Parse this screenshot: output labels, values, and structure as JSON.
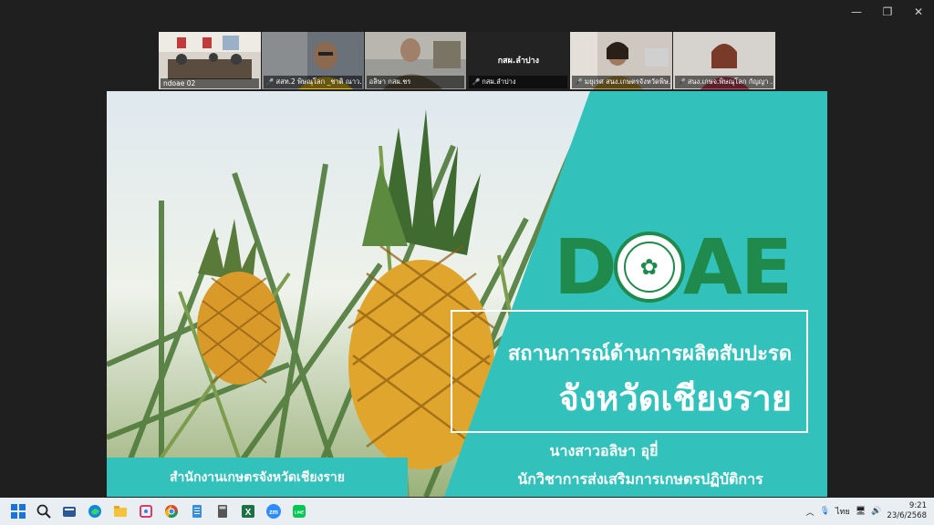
{
  "window": {
    "controls": {
      "minimize": "—",
      "restore": "❐",
      "close": "✕"
    }
  },
  "participants": [
    {
      "name": "ndoae 02",
      "mic_off": false,
      "active": false
    },
    {
      "name": "สสท.2 พิษณุโลก _ชาติ ณาว...",
      "mic_off": true,
      "active": false
    },
    {
      "name": "อลิษา กสผ.ชร",
      "mic_off": false,
      "active": true
    },
    {
      "name": "กสผ.ลำปาง",
      "center_label": "กสผ.ลำปาง",
      "mic_off": true,
      "active": false
    },
    {
      "name": "มยุเรศ สนง.เกษตรจังหวัดพิษ...",
      "mic_off": true,
      "active": false
    },
    {
      "name": "สนง.เกษจ.พิษณุโลก กัญญา ...",
      "mic_off": true,
      "active": false
    }
  ],
  "slide": {
    "logo_left": "D",
    "logo_right": "AE",
    "title_line1": "สถานการณ์ด้านการผลิตสับปะรด",
    "title_line2": "จังหวัดเชียงราย",
    "presenter_name": "นางสาวอลิษา  อุยี่",
    "presenter_role": "นักวิชาการส่งเสริมการเกษตรปฏิบัติการ",
    "office": "สำนักงานเกษตรจังหวัดเชียงราย",
    "colors": {
      "teal": "#33c2bb",
      "green": "#1f8a4c"
    }
  },
  "taskbar": {
    "apps": [
      "windows-start-icon",
      "search-icon",
      "task-view-icon",
      "edge-icon",
      "file-explorer-icon",
      "snipping-icon",
      "chrome-icon",
      "notepad-icon",
      "calculator-icon",
      "excel-icon",
      "zoom-icon",
      "line-icon"
    ],
    "zoom_label": "zm",
    "line_label": "LINE",
    "excel_label": "X",
    "language": "ไทย",
    "time": "9:21",
    "date": "23/6/2568"
  }
}
